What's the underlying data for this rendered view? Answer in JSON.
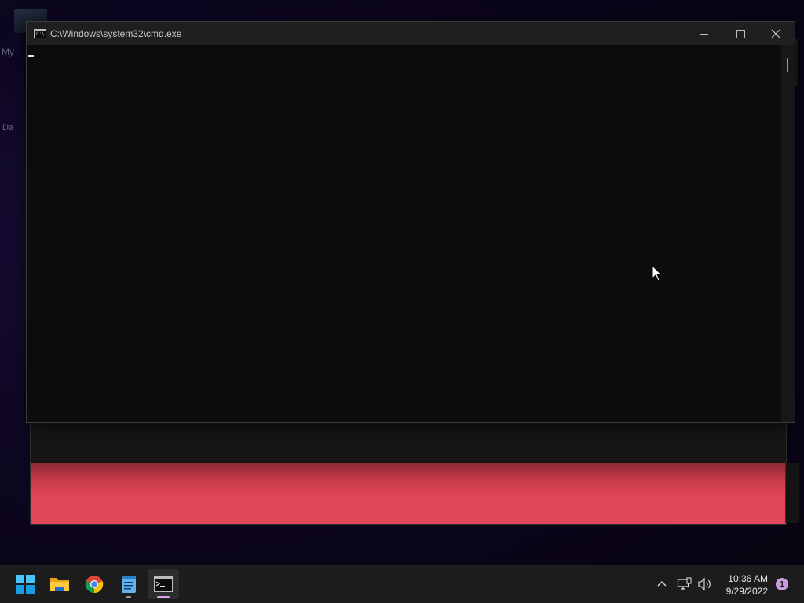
{
  "desktop": {
    "labels": [
      "My",
      "Da"
    ]
  },
  "cmd_window": {
    "title": "C:\\Windows\\system32\\cmd.exe",
    "icon": "cmd-icon",
    "icon_text": "C:\\",
    "console_text": ""
  },
  "taskbar": {
    "items": [
      {
        "name": "Start",
        "icon": "windows-logo-icon"
      },
      {
        "name": "File Explorer",
        "icon": "folder-icon"
      },
      {
        "name": "Google Chrome",
        "icon": "chrome-icon"
      },
      {
        "name": "Notepad",
        "icon": "notepad-icon"
      },
      {
        "name": "Command Prompt",
        "icon": "terminal-icon",
        "active": true
      }
    ],
    "clock": {
      "time": "10:36 AM",
      "date": "9/29/2022"
    },
    "notification_count": "1"
  },
  "colors": {
    "banner": "#e2485a",
    "accent": "#c99be0",
    "console_bg": "#0c0c0c"
  }
}
